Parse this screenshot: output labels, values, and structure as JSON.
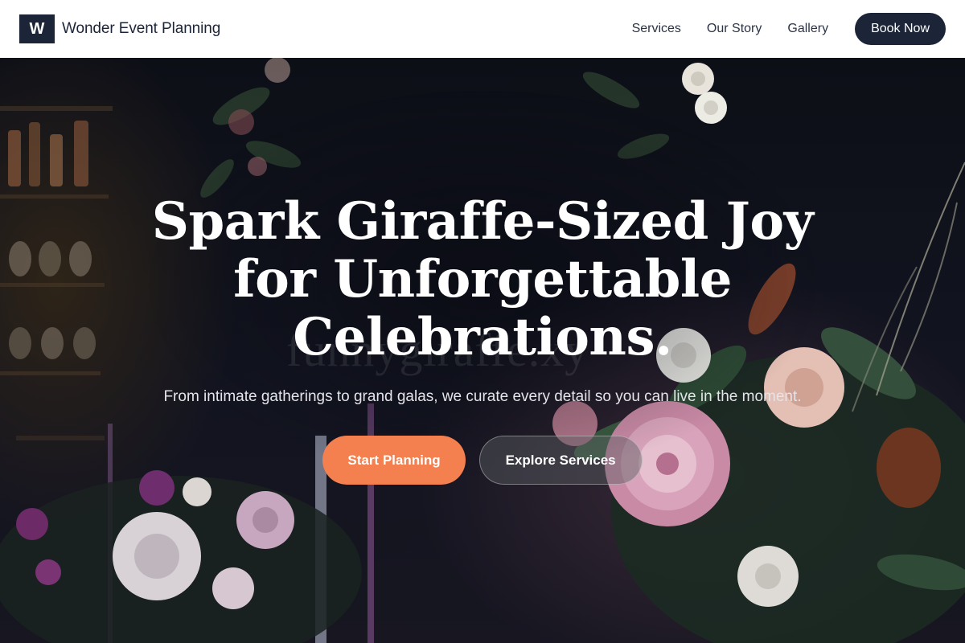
{
  "header": {
    "logo_letter": "W",
    "brand_name": "Wonder Event Planning",
    "nav": [
      {
        "label": "Services"
      },
      {
        "label": "Our Story"
      },
      {
        "label": "Gallery"
      }
    ],
    "cta_label": "Book Now"
  },
  "hero": {
    "title": "Spark Giraffe-Sized Joy for Unforgettable Celebrations.",
    "watermark_text": "funnygiraffe.xy",
    "subtitle": "From intimate gatherings to grand galas, we curate every detail so you can live in the moment.",
    "primary_cta": "Start Planning",
    "secondary_cta": "Explore Services",
    "background_image": "dark-floral-event-photo"
  },
  "colors": {
    "brand_navy": "#1c2538",
    "accent_orange": "#f5804f",
    "header_bg": "#ffffff"
  }
}
